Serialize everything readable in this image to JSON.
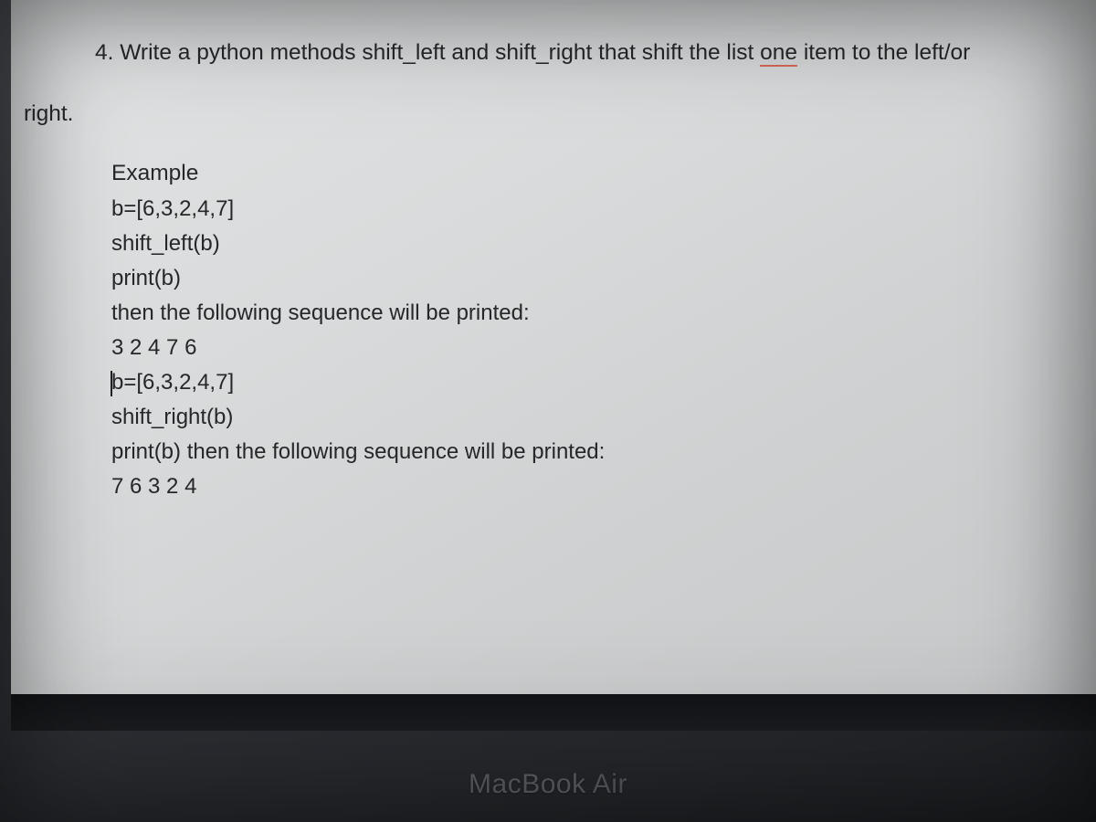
{
  "question": {
    "prefix": "4. ",
    "line1": "Write a python methods shift_left and shift_right that shift the list ",
    "underlined": "one",
    "line1_after": " item to the left/or",
    "line2": "right."
  },
  "example": {
    "heading": "Example",
    "lines": [
      "b=[6,3,2,4,7]",
      " shift_left(b)",
      "print(b)",
      "then the following sequence will be printed:",
      "3 2 4 7 6",
      "b=[6,3,2,4,7]",
      "shift_right(b)",
      "print(b) then the following sequence will be printed:",
      "7 6 3 2 4"
    ],
    "cursor_line_index": 5
  },
  "device_label": {
    "bold": "MacBook",
    "light": " Air"
  }
}
